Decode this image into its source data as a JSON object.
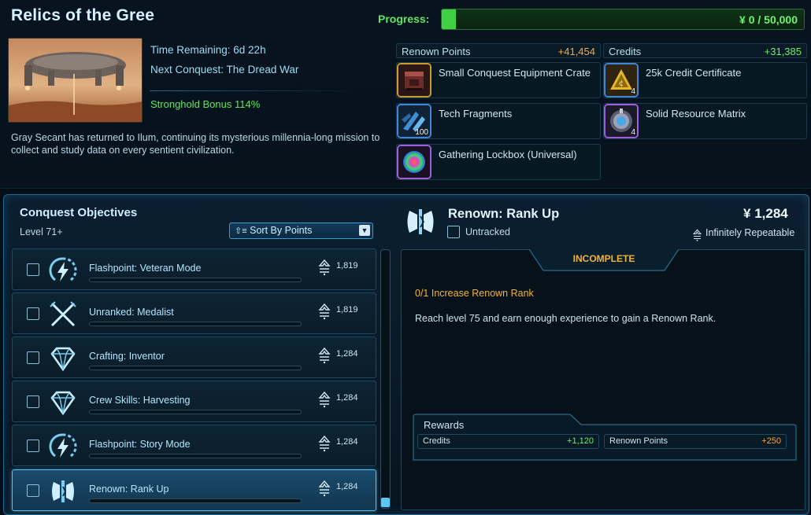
{
  "header": {
    "title": "Relics of the Gree",
    "progress_label": "Progress:",
    "progress_value": "0 / 50,000",
    "progress_fraction": 0.04,
    "currency_glyph": "¥",
    "colors": {
      "progress_green": "#5fe65f",
      "accent_blue": "#5cc6f5",
      "points_orange": "#f0a94a"
    }
  },
  "event": {
    "time_remaining": "Time Remaining: 6d 22h",
    "next_conquest": "Next Conquest: The Dread War",
    "stronghold_bonus": "Stronghold Bonus 114%",
    "description": "Gray Secant has returned to Ilum, continuing its mysterious millennia-long mission to collect and study data on every sentient civilization."
  },
  "rewards": {
    "renown_label": "Renown Points",
    "renown_value": "+41,454",
    "credits_label": "Credits",
    "credits_value": "+31,385",
    "items": [
      {
        "name": "Small Conquest Equipment Crate",
        "count": "",
        "icon": "crate-icon"
      },
      {
        "name": "25k Credit Certificate",
        "count": "4",
        "icon": "credit-certificate-icon"
      },
      {
        "name": "Tech Fragments",
        "count": "100",
        "icon": "tech-fragments-icon"
      },
      {
        "name": "Solid Resource Matrix",
        "count": "4",
        "icon": "resource-matrix-icon"
      },
      {
        "name": "Gathering Lockbox (Universal)",
        "count": "",
        "icon": "lockbox-orb-icon"
      }
    ]
  },
  "objectives": {
    "title": "Conquest Objectives",
    "level": "Level 71+",
    "sort_label": "Sort By Points",
    "rows": [
      {
        "name": "Flashpoint: Veteran Mode",
        "points": "1,819",
        "icon": "flashpoint-icon"
      },
      {
        "name": "Unranked: Medalist",
        "points": "1,819",
        "icon": "crossed-swords-icon"
      },
      {
        "name": "Crafting: Inventor",
        "points": "1,284",
        "icon": "diamond-icon"
      },
      {
        "name": "Crew Skills: Harvesting",
        "points": "1,284",
        "icon": "diamond-icon"
      },
      {
        "name": "Flashpoint: Story Mode",
        "points": "1,284",
        "icon": "flashpoint-icon"
      },
      {
        "name": "Renown: Rank Up",
        "points": "1,284",
        "icon": "renown-icon"
      }
    ]
  },
  "detail": {
    "title": "Renown: Rank Up",
    "tracked": "Untracked",
    "points": "1,284",
    "repeat": "Infinitely Repeatable",
    "status": "INCOMPLETE",
    "task": "0/1 Increase Renown Rank",
    "task_desc": "Reach level 75 and earn enough experience to gain a Renown Rank.",
    "rewards_title": "Rewards",
    "reward_credits_label": "Credits",
    "reward_credits_value": "+1,120",
    "reward_renown_label": "Renown Points",
    "reward_renown_value": "+250"
  }
}
